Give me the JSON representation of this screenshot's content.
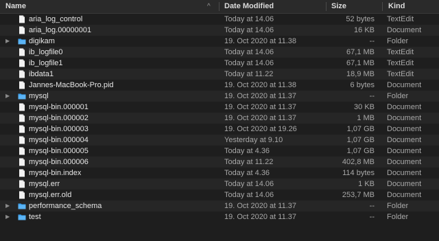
{
  "header": {
    "name_label": "Name",
    "date_label": "Date Modified",
    "size_label": "Size",
    "kind_label": "Kind",
    "sort_indicator": "^"
  },
  "colors": {
    "folder": "#3aa0ef",
    "document": "#f2f2f2",
    "background": "#1e1e1e",
    "alt_row": "#262626"
  },
  "rows": [
    {
      "name": "aria_log_control",
      "date": "Today at 14.06",
      "size": "52 bytes",
      "kind": "TextEdit",
      "type": "document-icon",
      "expandable": false
    },
    {
      "name": "aria_log.00000001",
      "date": "Today at 14.06",
      "size": "16 KB",
      "kind": "Document",
      "type": "document-icon",
      "expandable": false
    },
    {
      "name": "digikam",
      "date": "19. Oct 2020 at 11.38",
      "size": "--",
      "kind": "Folder",
      "type": "folder-icon",
      "expandable": true
    },
    {
      "name": "ib_logfile0",
      "date": "Today at 14.06",
      "size": "67,1 MB",
      "kind": "TextEdit",
      "type": "document-icon",
      "expandable": false
    },
    {
      "name": "ib_logfile1",
      "date": "Today at 14.06",
      "size": "67,1 MB",
      "kind": "TextEdit",
      "type": "document-icon",
      "expandable": false
    },
    {
      "name": "ibdata1",
      "date": "Today at 11.22",
      "size": "18,9 MB",
      "kind": "TextEdit",
      "type": "document-icon",
      "expandable": false
    },
    {
      "name": "Jannes-MacBook-Pro.pid",
      "date": "19. Oct 2020 at 11.38",
      "size": "6 bytes",
      "kind": "Document",
      "type": "document-icon",
      "expandable": false
    },
    {
      "name": "mysql",
      "date": "19. Oct 2020 at 11.37",
      "size": "--",
      "kind": "Folder",
      "type": "folder-icon",
      "expandable": true
    },
    {
      "name": "mysql-bin.000001",
      "date": "19. Oct 2020 at 11.37",
      "size": "30 KB",
      "kind": "Document",
      "type": "document-icon",
      "expandable": false
    },
    {
      "name": "mysql-bin.000002",
      "date": "19. Oct 2020 at 11.37",
      "size": "1 MB",
      "kind": "Document",
      "type": "document-icon",
      "expandable": false
    },
    {
      "name": "mysql-bin.000003",
      "date": "19. Oct 2020 at 19.26",
      "size": "1,07 GB",
      "kind": "Document",
      "type": "document-icon",
      "expandable": false
    },
    {
      "name": "mysql-bin.000004",
      "date": "Yesterday at 9.10",
      "size": "1,07 GB",
      "kind": "Document",
      "type": "document-icon",
      "expandable": false
    },
    {
      "name": "mysql-bin.000005",
      "date": "Today at 4.36",
      "size": "1,07 GB",
      "kind": "Document",
      "type": "document-icon",
      "expandable": false
    },
    {
      "name": "mysql-bin.000006",
      "date": "Today at 11.22",
      "size": "402,8 MB",
      "kind": "Document",
      "type": "document-icon",
      "expandable": false
    },
    {
      "name": "mysql-bin.index",
      "date": "Today at 4.36",
      "size": "114 bytes",
      "kind": "Document",
      "type": "document-icon",
      "expandable": false
    },
    {
      "name": "mysql.err",
      "date": "Today at 14.06",
      "size": "1 KB",
      "kind": "Document",
      "type": "document-icon",
      "expandable": false
    },
    {
      "name": "mysql.err.old",
      "date": "Today at 14.06",
      "size": "253,7 MB",
      "kind": "Document",
      "type": "document-icon",
      "expandable": false
    },
    {
      "name": "performance_schema",
      "date": "19. Oct 2020 at 11.37",
      "size": "--",
      "kind": "Folder",
      "type": "folder-icon",
      "expandable": true
    },
    {
      "name": "test",
      "date": "19. Oct 2020 at 11.37",
      "size": "--",
      "kind": "Folder",
      "type": "folder-icon",
      "expandable": true
    }
  ]
}
